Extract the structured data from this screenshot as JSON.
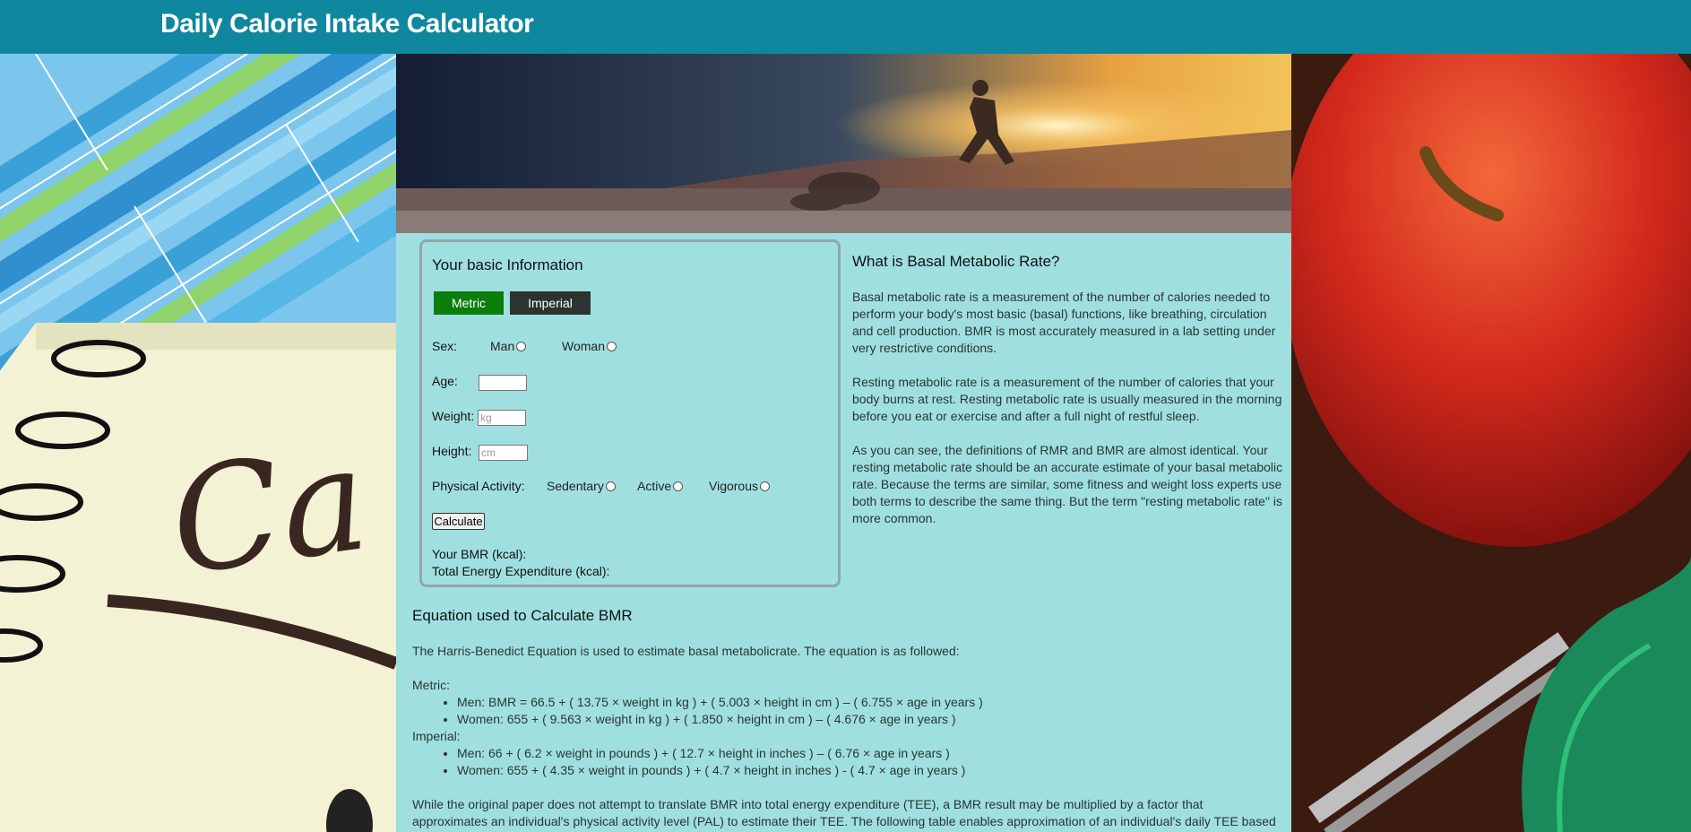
{
  "header": {
    "title": "Daily Calorie Intake Calculator"
  },
  "form": {
    "title": "Your basic Information",
    "units": {
      "metric_label": "Metric",
      "imperial_label": "Imperial",
      "selected": "Metric"
    },
    "sex": {
      "label": "Sex:",
      "options": [
        "Man",
        "Woman"
      ]
    },
    "age": {
      "label": "Age:",
      "value": ""
    },
    "weight": {
      "label": "Weight:",
      "placeholder": "kg"
    },
    "height": {
      "label": "Height:",
      "placeholder": "cm"
    },
    "activity": {
      "label": "Physical Activity:",
      "options": [
        "Sedentary",
        "Active",
        "Vigorous"
      ]
    },
    "calculate_label": "Calculate",
    "bmr_label": "Your BMR (kcal):",
    "tee_label": "Total Energy Expenditure (kcal):"
  },
  "info": {
    "title": "What is Basal Metabolic Rate?",
    "paragraphs": [
      "Basal metabolic rate is a measurement of the number of calories needed to perform your body's most basic (basal) functions, like breathing, circulation and cell production. BMR is most accurately measured in a lab setting under very restrictive conditions.",
      "Resting metabolic rate is a measurement of the number of calories that your body burns at rest. Resting metabolic rate is usually measured in the morning before you eat or exercise and after a full night of restful sleep.",
      "As you can see, the definitions of RMR and BMR are almost identical. Your resting metabolic rate should be an accurate estimate of your basal metabolic rate. Because the terms are similar, some fitness and weight loss experts use both terms to describe the same thing. But the term \"resting metabolic rate\" is more common."
    ]
  },
  "equation": {
    "title": "Equation used to Calculate BMR",
    "intro": "The Harris-Benedict Equation is used to estimate basal metabolicrate. The equation is as followed:",
    "metric_label": "Metric:",
    "metric_items": [
      "Men: BMR = 66.5 + ( 13.75 × weight in kg ) + ( 5.003 × height in cm ) – ( 6.755 × age in years )",
      "Women: 655 + ( 9.563 × weight in kg ) + ( 1.850 × height in cm ) – ( 4.676 × age in years )"
    ],
    "imperial_label": "Imperial:",
    "imperial_items": [
      "Men: 66 + ( 6.2 × weight in pounds ) + ( 12.7 × height in inches ) – ( 6.76 × age in years )",
      "Women: 655 + ( 4.35 × weight in pounds ) + ( 4.7 × height in inches ) - ( 4.7 × age in years )"
    ],
    "footer": "While the original paper does not attempt to translate BMR into total energy expenditure (TEE), a BMR result may be multiplied by a factor that approximates an individual's physical activity level (PAL) to estimate their TEE. The following table enables approximation of an individual's daily TEE based on some"
  },
  "background": {
    "left_image": "calories-notepad-chart",
    "right_image": "red-apple-fork-measuring-tape",
    "hero_image": "runner-at-sunset"
  },
  "colors": {
    "header": "#0f879e",
    "content_bg": "#a0dfe0",
    "metric_button": "#0a7d0a",
    "imperial_button": "#2c3331"
  }
}
